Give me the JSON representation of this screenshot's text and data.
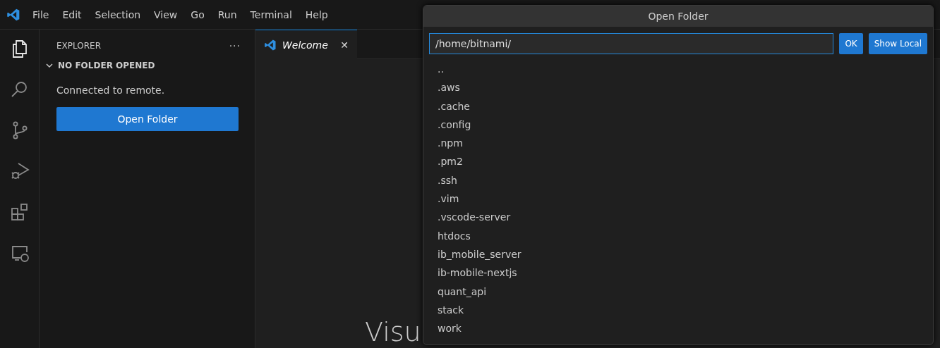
{
  "menu": [
    "File",
    "Edit",
    "Selection",
    "View",
    "Go",
    "Run",
    "Terminal",
    "Help"
  ],
  "activity_bar": [
    {
      "kind": "explorer",
      "selected": true
    },
    {
      "kind": "search",
      "selected": false
    },
    {
      "kind": "source-control",
      "selected": false
    },
    {
      "kind": "run-debug",
      "selected": false
    },
    {
      "kind": "extensions",
      "selected": false
    },
    {
      "kind": "remote",
      "selected": false
    }
  ],
  "sidebar": {
    "title": "EXPLORER",
    "more": "···",
    "section": {
      "title": "NO FOLDER OPENED",
      "expanded": true
    },
    "message": "Connected to remote.",
    "button": "Open Folder"
  },
  "tabs": [
    {
      "label": "Welcome",
      "selected": true,
      "close": "✕"
    }
  ],
  "editor": {
    "heading": "Visu"
  },
  "dialog": {
    "title": "Open Folder",
    "path": "/home/bitnami/",
    "buttons": [
      "OK",
      "Show Local"
    ],
    "items": [
      "..",
      ".aws",
      ".cache",
      ".config",
      ".npm",
      ".pm2",
      ".ssh",
      ".vim",
      ".vscode-server",
      "htdocs",
      "ib_mobile_server",
      "ib-mobile-nextjs",
      "quant_api",
      "stack",
      "work"
    ]
  }
}
